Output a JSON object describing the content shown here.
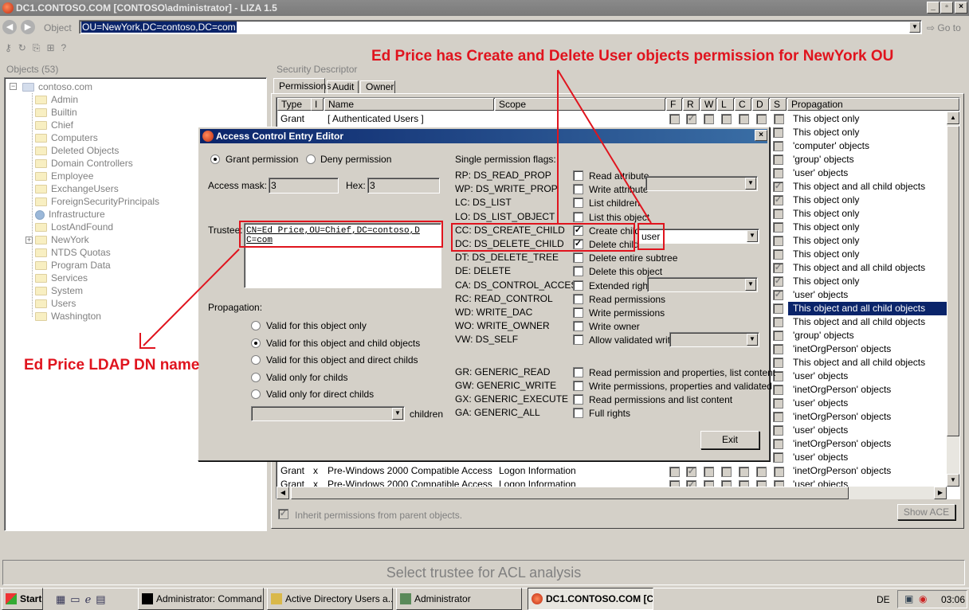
{
  "window": {
    "title": "DC1.CONTOSO.COM [CONTOSO\\administrator] - LIZA 1.5"
  },
  "nav": {
    "object_label": "Object",
    "object_value": "OU=NewYork,DC=contoso,DC=com",
    "goto_label": "Go to"
  },
  "objects": {
    "header": "Objects (53)",
    "root": "contoso.com",
    "items": [
      "Admin",
      "Builtin",
      "Chief",
      "Computers",
      "Deleted Objects",
      "Domain Controllers",
      "Employee",
      "ExchangeUsers",
      "ForeignSecurityPrincipals",
      "Infrastructure",
      "LostAndFound",
      "NewYork",
      "NTDS Quotas",
      "Program Data",
      "Services",
      "System",
      "Users",
      "Washington"
    ]
  },
  "security": {
    "header": "Security Descriptor",
    "tabs": [
      "Permissions",
      "Audit",
      "Owner"
    ],
    "columns": [
      "Type",
      "I",
      "Name",
      "Scope",
      "F",
      "R",
      "W",
      "L",
      "C",
      "D",
      "S",
      "Propagation"
    ],
    "first_row": {
      "type": "Grant",
      "name": "[ Authenticated Users ]",
      "propagation": "This object only"
    },
    "bottom_rows": [
      {
        "type": "Grant",
        "i": "x",
        "name": "Pre-Windows 2000 Compatible Access",
        "scope": "Logon Information",
        "propagation": "'inetOrgPerson' objects"
      },
      {
        "type": "Grant",
        "i": "x",
        "name": "Pre-Windows 2000 Compatible Access",
        "scope": "Logon Information",
        "propagation": "'user' objects"
      }
    ],
    "propagation_list": [
      "This object only",
      "'computer' objects",
      "'group' objects",
      "'user' objects",
      "This object and all child objects",
      "This object only",
      "This object only",
      "This object only",
      "This object only",
      "This object only",
      "This object and all child objects",
      "This object only",
      "'user' objects",
      "This object and all child objects",
      "This object and all child objects",
      "'group' objects",
      "'inetOrgPerson' objects",
      "This object and all child objects",
      "'user' objects",
      "'inetOrgPerson' objects",
      "'user' objects",
      "'inetOrgPerson' objects",
      "'user' objects",
      "'inetOrgPerson' objects",
      "'user' objects"
    ],
    "inherit_label": "Inherit permissions from parent objects.",
    "show_ace": "Show ACE"
  },
  "dialog": {
    "title": "Access Control Entry Editor",
    "grant": "Grant permission",
    "deny": "Deny permission",
    "mask_label": "Access mask:",
    "mask_value": "3",
    "hex_label": "Hex:",
    "hex_value": "3",
    "trustee_label": "Trustee:",
    "trustee_line1": "CN=Ed Price,OU=Chief,DC=contoso,D",
    "trustee_line2": "C=com",
    "propagation_label": "Propagation:",
    "propagation_options": [
      "Valid for this object only",
      "Valid for this object and child objects",
      "Valid for this object and direct childs",
      "Valid only for childs",
      "Valid only for direct childs"
    ],
    "children_label": "children",
    "flags_header": "Single permission flags:",
    "flags": [
      {
        "code": "RP: DS_READ_PROP",
        "label": "Read attribute"
      },
      {
        "code": "WP: DS_WRITE_PROP",
        "label": "Write attribute"
      },
      {
        "code": "LC: DS_LIST",
        "label": "List children"
      },
      {
        "code": "LO: DS_LIST_OBJECT",
        "label": "List this object"
      },
      {
        "code": "CC: DS_CREATE_CHILD",
        "label": "Create child"
      },
      {
        "code": "DC: DS_DELETE_CHILD",
        "label": "Delete child"
      },
      {
        "code": "DT: DS_DELETE_TREE",
        "label": "Delete entire subtree"
      },
      {
        "code": "DE: DELETE",
        "label": "Delete this object"
      },
      {
        "code": "CA: DS_CONTROL_ACCESS",
        "label": "Extended right"
      },
      {
        "code": "RC: READ_CONTROL",
        "label": "Read permissions"
      },
      {
        "code": "WD: WRITE_DAC",
        "label": "Write permissions"
      },
      {
        "code": "WO: WRITE_OWNER",
        "label": "Write owner"
      },
      {
        "code": "VW: DS_SELF",
        "label": "Allow validated write"
      }
    ],
    "generic": [
      {
        "code": "GR: GENERIC_READ",
        "label": "Read permission and properties, list content"
      },
      {
        "code": "GW: GENERIC_WRITE",
        "label": "Write permissions, properties and validated"
      },
      {
        "code": "GX: GENERIC_EXECUTE",
        "label": "Read permissions and list content"
      },
      {
        "code": "GA: GENERIC_ALL",
        "label": "Full rights"
      }
    ],
    "child_object": "user",
    "exit": "Exit"
  },
  "annotations": {
    "top": "Ed Price has Create and Delete User objects permission for NewYork OU",
    "left": "Ed Price LDAP DN name"
  },
  "status": "Select trustee for ACL analysis",
  "taskbar": {
    "start": "Start",
    "items": [
      "Administrator: Command...",
      "Active Directory Users a...",
      "Administrator",
      "DC1.CONTOSO.COM [C..."
    ],
    "lang": "DE",
    "clock": "03:06"
  }
}
